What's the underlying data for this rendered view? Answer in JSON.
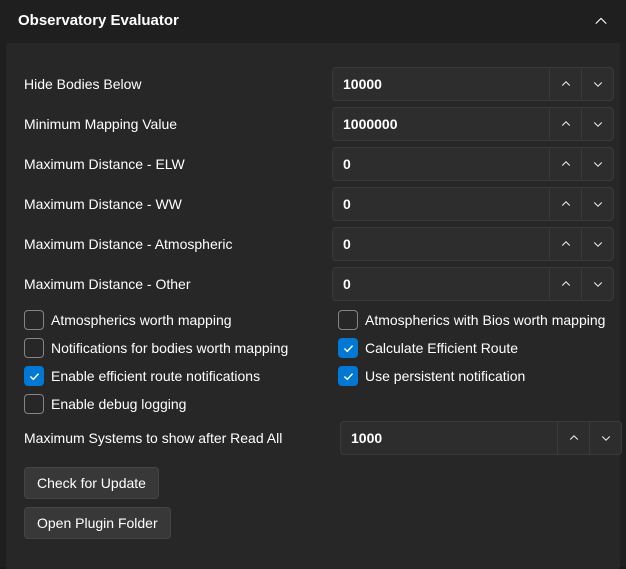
{
  "header": {
    "title": "Observatory Evaluator"
  },
  "fields": {
    "hide_bodies": {
      "label": "Hide Bodies Below",
      "value": "10000"
    },
    "min_mapping": {
      "label": "Minimum Mapping Value",
      "value": "1000000"
    },
    "max_elw": {
      "label": "Maximum Distance - ELW",
      "value": "0"
    },
    "max_ww": {
      "label": "Maximum Distance - WW",
      "value": "0"
    },
    "max_atm": {
      "label": "Maximum Distance - Atmospheric",
      "value": "0"
    },
    "max_other": {
      "label": "Maximum Distance - Other",
      "value": "0"
    },
    "max_systems": {
      "label": "Maximum Systems to show after Read All",
      "value": "1000"
    }
  },
  "checkboxes": {
    "atm_worth": {
      "label": "Atmospherics worth mapping",
      "checked": false
    },
    "atm_bios": {
      "label": "Atmospherics with Bios worth mapping",
      "checked": false
    },
    "notif_bodies": {
      "label": "Notifications for bodies worth mapping",
      "checked": false
    },
    "calc_route": {
      "label": "Calculate Efficient Route",
      "checked": true
    },
    "enable_route_notif": {
      "label": "Enable efficient route notifications",
      "checked": true
    },
    "persist_notif": {
      "label": "Use persistent notification",
      "checked": true
    },
    "debug_log": {
      "label": "Enable debug logging",
      "checked": false
    }
  },
  "buttons": {
    "check_update": "Check for Update",
    "open_folder": "Open Plugin Folder"
  }
}
